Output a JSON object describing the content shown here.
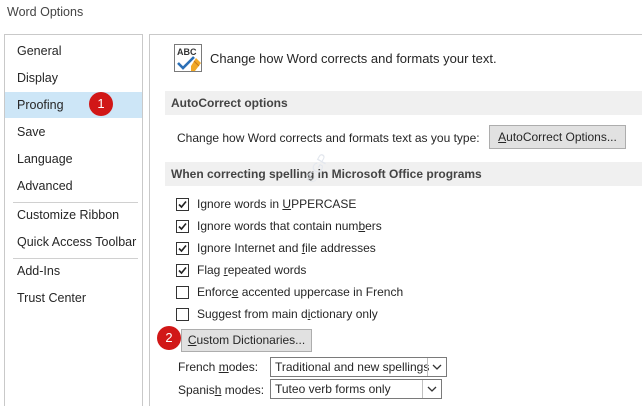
{
  "window": {
    "title": "Word Options"
  },
  "sidebar": {
    "items": [
      {
        "label": "General"
      },
      {
        "label": "Display"
      },
      {
        "label": "Proofing"
      },
      {
        "label": "Save"
      },
      {
        "label": "Language"
      },
      {
        "label": "Advanced"
      },
      {
        "label": "Customize Ribbon"
      },
      {
        "label": "Quick Access Toolbar"
      },
      {
        "label": "Add-Ins"
      },
      {
        "label": "Trust Center"
      }
    ],
    "selected": "Proofing"
  },
  "header": {
    "icon_text": "ABC",
    "text": "Change how Word corrects and formats your text."
  },
  "autocorrect_section": {
    "title": "AutoCorrect options",
    "description": "Change how Word corrects and formats text as you type:",
    "button_pre": "",
    "button_key": "A",
    "button_post": "utoCorrect Options..."
  },
  "spelling_section": {
    "title": "When correcting spelling in Microsoft Office programs",
    "options": [
      {
        "pre": "Ignore words in ",
        "key": "U",
        "post": "PPERCASE",
        "checked": true
      },
      {
        "pre": "Ignore words that contain num",
        "key": "b",
        "post": "ers",
        "checked": true
      },
      {
        "pre": "Ignore Internet and ",
        "key": "f",
        "post": "ile addresses",
        "checked": true
      },
      {
        "pre": "Flag ",
        "key": "r",
        "post": "epeated words",
        "checked": true
      },
      {
        "pre": "Enforc",
        "key": "e",
        "post": " accented uppercase in French",
        "checked": false
      },
      {
        "pre": "Suggest from main d",
        "key": "i",
        "post": "ctionary only",
        "checked": false
      }
    ],
    "custom_dict_pre": "",
    "custom_dict_key": "C",
    "custom_dict_post": "ustom Dictionaries...",
    "french_label_pre": "French ",
    "french_label_key": "m",
    "french_label_post": "odes:",
    "french_value": "Traditional and new spellings",
    "spanish_label_pre": "Spanis",
    "spanish_label_key": "h",
    "spanish_label_post": " modes:",
    "spanish_value": "Tuteo verb forms only"
  },
  "annotations": [
    {
      "number": "1"
    },
    {
      "number": "2"
    }
  ],
  "watermark": "©GP"
}
